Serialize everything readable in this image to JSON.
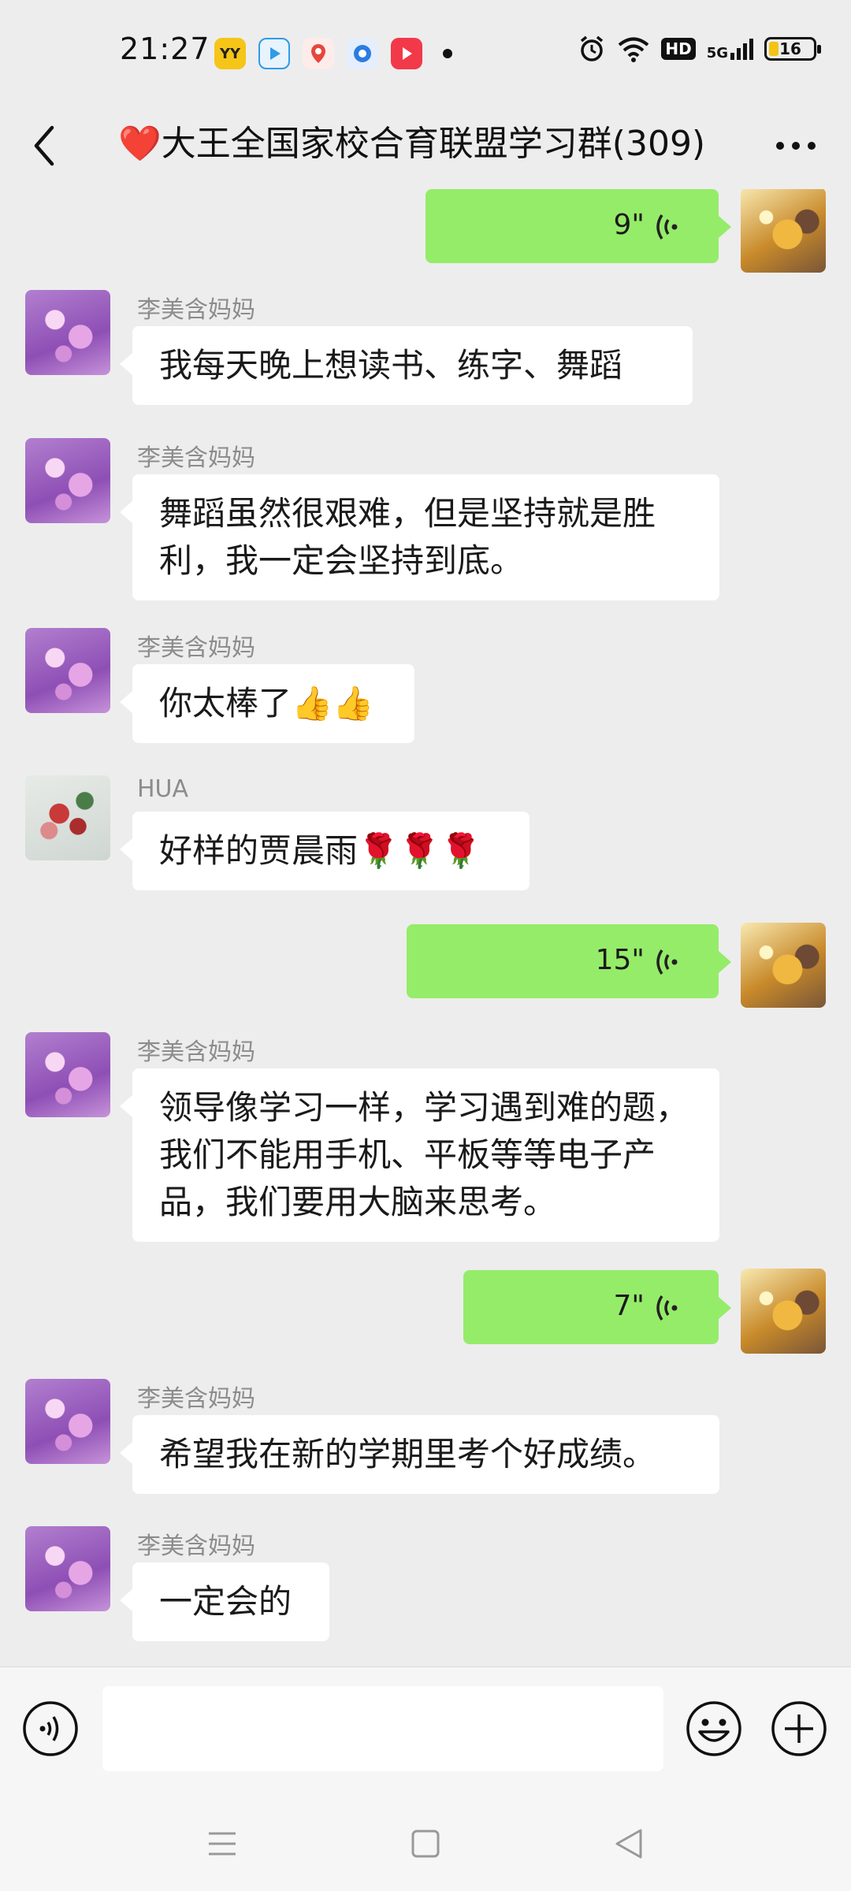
{
  "status_bar": {
    "time": "21:27",
    "app_icons": [
      {
        "name": "yy-app-icon",
        "label": "YY",
        "color": "#f5c518"
      },
      {
        "name": "video-app-icon",
        "label": "",
        "color": "#2f9be8"
      },
      {
        "name": "map-app-icon",
        "label": "",
        "color": "#e8453c"
      },
      {
        "name": "browser-app-icon",
        "label": "",
        "color": "#2a7de1"
      },
      {
        "name": "player-app-icon",
        "label": "",
        "color": "#f2394a"
      }
    ],
    "hd_label": "HD",
    "network_label": "5G",
    "battery_level": "16"
  },
  "header": {
    "title": "❤️大王全国家校合育联盟学习群(309)"
  },
  "messages": [
    {
      "side": "out",
      "type": "voice",
      "duration": "9\""
    },
    {
      "side": "in",
      "sender": "李美含妈妈",
      "avatar": "flower-butterfly",
      "text": "我每天晚上想读书、练字、舞蹈"
    },
    {
      "side": "in",
      "sender": "李美含妈妈",
      "avatar": "flower-butterfly",
      "text": "舞蹈虽然很艰难，但是坚持就是胜利，我一定会坚持到底。"
    },
    {
      "side": "in",
      "sender": "李美含妈妈",
      "avatar": "flower-butterfly",
      "text": "你太棒了👍👍"
    },
    {
      "side": "in",
      "sender": "HUA",
      "avatar": "peony-painting",
      "text": "好样的贾晨雨🌹🌹🌹"
    },
    {
      "side": "out",
      "type": "voice",
      "duration": "15\""
    },
    {
      "side": "in",
      "sender": "李美含妈妈",
      "avatar": "flower-butterfly",
      "text": "领导像学习一样，学习遇到难的题，我们不能用手机、平板等等电子产品，我们要用大脑来思考。"
    },
    {
      "side": "out",
      "type": "voice",
      "duration": "7\""
    },
    {
      "side": "in",
      "sender": "李美含妈妈",
      "avatar": "flower-butterfly",
      "text": "希望我在新的学期里考个好成绩。"
    },
    {
      "side": "in",
      "sender": "李美含妈妈",
      "avatar": "flower-butterfly",
      "text": "一定会的"
    }
  ],
  "input_bar": {
    "value": "",
    "placeholder": ""
  },
  "colors": {
    "background": "#ededed",
    "outgoing_bubble": "#95ec69",
    "incoming_bubble": "#ffffff",
    "sender_name": "#8c8c8c"
  }
}
